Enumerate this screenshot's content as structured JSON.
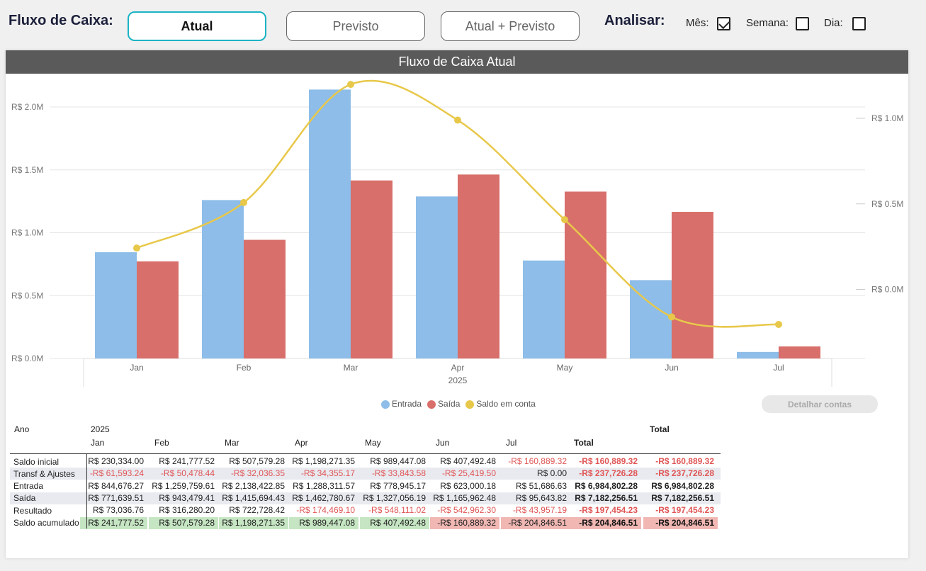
{
  "topbar": {
    "title": "Fluxo de Caixa:",
    "buttons": [
      {
        "label": "Atual",
        "active": true
      },
      {
        "label": "Previsto",
        "active": false
      },
      {
        "label": "Atual + Previsto",
        "active": false
      }
    ],
    "analisar_label": "Analisar:",
    "checks": [
      {
        "label": "Mês:",
        "checked": true
      },
      {
        "label": "Semana:",
        "checked": false
      },
      {
        "label": "Dia:",
        "checked": false
      }
    ]
  },
  "chart_title": "Fluxo de Caixa Atual",
  "chart_data": {
    "type": "bar",
    "categories": [
      "Jan",
      "Feb",
      "Mar",
      "Apr",
      "May",
      "Jun",
      "Jul"
    ],
    "x_group_label": "2025",
    "series": [
      {
        "name": "Entrada",
        "values": [
          844676.27,
          1259759.61,
          2138422.85,
          1288311.57,
          778945.17,
          623000.18,
          51686.63
        ],
        "color": "#8dbde8"
      },
      {
        "name": "Saída",
        "values": [
          771639.51,
          943479.41,
          1415694.43,
          1462780.67,
          1327056.19,
          1165962.48,
          95643.82
        ],
        "color": "#d86f6a"
      },
      {
        "name": "Saldo em conta",
        "type": "line",
        "axis": "right",
        "values": [
          241777.52,
          507579.28,
          1198271.35,
          989447.08,
          407492.48,
          -160889.32,
          -204846.51
        ],
        "color": "#e8c84a"
      }
    ],
    "y_left_ticks": [
      "R$ 0.0M",
      "R$ 0.5M",
      "R$ 1.0M",
      "R$ 1.5M",
      "R$ 2.0M"
    ],
    "y_left_range": [
      0,
      2200000
    ],
    "y_right_ticks": [
      "R$ 0.0M",
      "R$ 0.5M",
      "R$ 1.0M"
    ],
    "y_right_range": [
      -416000,
      1380000
    ],
    "legend_position": "bottom"
  },
  "detail_button": "Detalhar contas",
  "table": {
    "row_header": "Ano",
    "year": "2025",
    "total_header": "Total",
    "months": [
      "Jan",
      "Feb",
      "Mar",
      "Apr",
      "May",
      "Jun",
      "Jul",
      "Total"
    ],
    "rows": [
      {
        "label": "Saldo inicial",
        "cells": [
          "R$ 230,334.00",
          "R$ 241,777.52",
          "R$ 507,579.28",
          "R$ 1,198,271.35",
          "R$ 989,447.08",
          "R$ 407,492.48",
          "-R$ 160,889.32",
          "-R$ 160,889.32",
          "-R$ 160,889.32"
        ]
      },
      {
        "label": "Transf & Ajustes",
        "cells": [
          "-R$ 61,593.24",
          "-R$ 50,478.44",
          "-R$ 32,036.35",
          "-R$ 34,355.17",
          "-R$ 33,843.58",
          "-R$ 25,419.50",
          "R$ 0.00",
          "-R$ 237,726.28",
          "-R$ 237,726.28"
        ]
      },
      {
        "label": "Entrada",
        "cells": [
          "R$ 844,676.27",
          "R$ 1,259,759.61",
          "R$ 2,138,422.85",
          "R$ 1,288,311.57",
          "R$ 778,945.17",
          "R$ 623,000.18",
          "R$ 51,686.63",
          "R$ 6,984,802.28",
          "R$ 6,984,802.28"
        ]
      },
      {
        "label": "Saída",
        "cells": [
          "R$ 771,639.51",
          "R$ 943,479.41",
          "R$ 1,415,694.43",
          "R$ 1,462,780.67",
          "R$ 1,327,056.19",
          "R$ 1,165,962.48",
          "R$ 95,643.82",
          "R$ 7,182,256.51",
          "R$ 7,182,256.51"
        ]
      },
      {
        "label": "Resultado",
        "cells": [
          "R$ 73,036.76",
          "R$ 316,280.20",
          "R$ 722,728.42",
          "-R$ 174,469.10",
          "-R$ 548,111.02",
          "-R$ 542,962.30",
          "-R$ 43,957.19",
          "-R$ 197,454.23",
          "-R$ 197,454.23"
        ]
      },
      {
        "label": "Saldo acumulado",
        "cells": [
          "R$ 241,777.52",
          "R$ 507,579.28",
          "R$ 1,198,271.35",
          "R$ 989,447.08",
          "R$ 407,492.48",
          "-R$ 160,889.32",
          "-R$ 204,846.51",
          "-R$ 204,846.51",
          "-R$ 204,846.51"
        ]
      }
    ],
    "colors": {
      "negative": "#e05555",
      "positive_bg": "#c6e6c3",
      "negative_bg": "#f0b7b3",
      "stripe": "#e8eaf0"
    }
  }
}
